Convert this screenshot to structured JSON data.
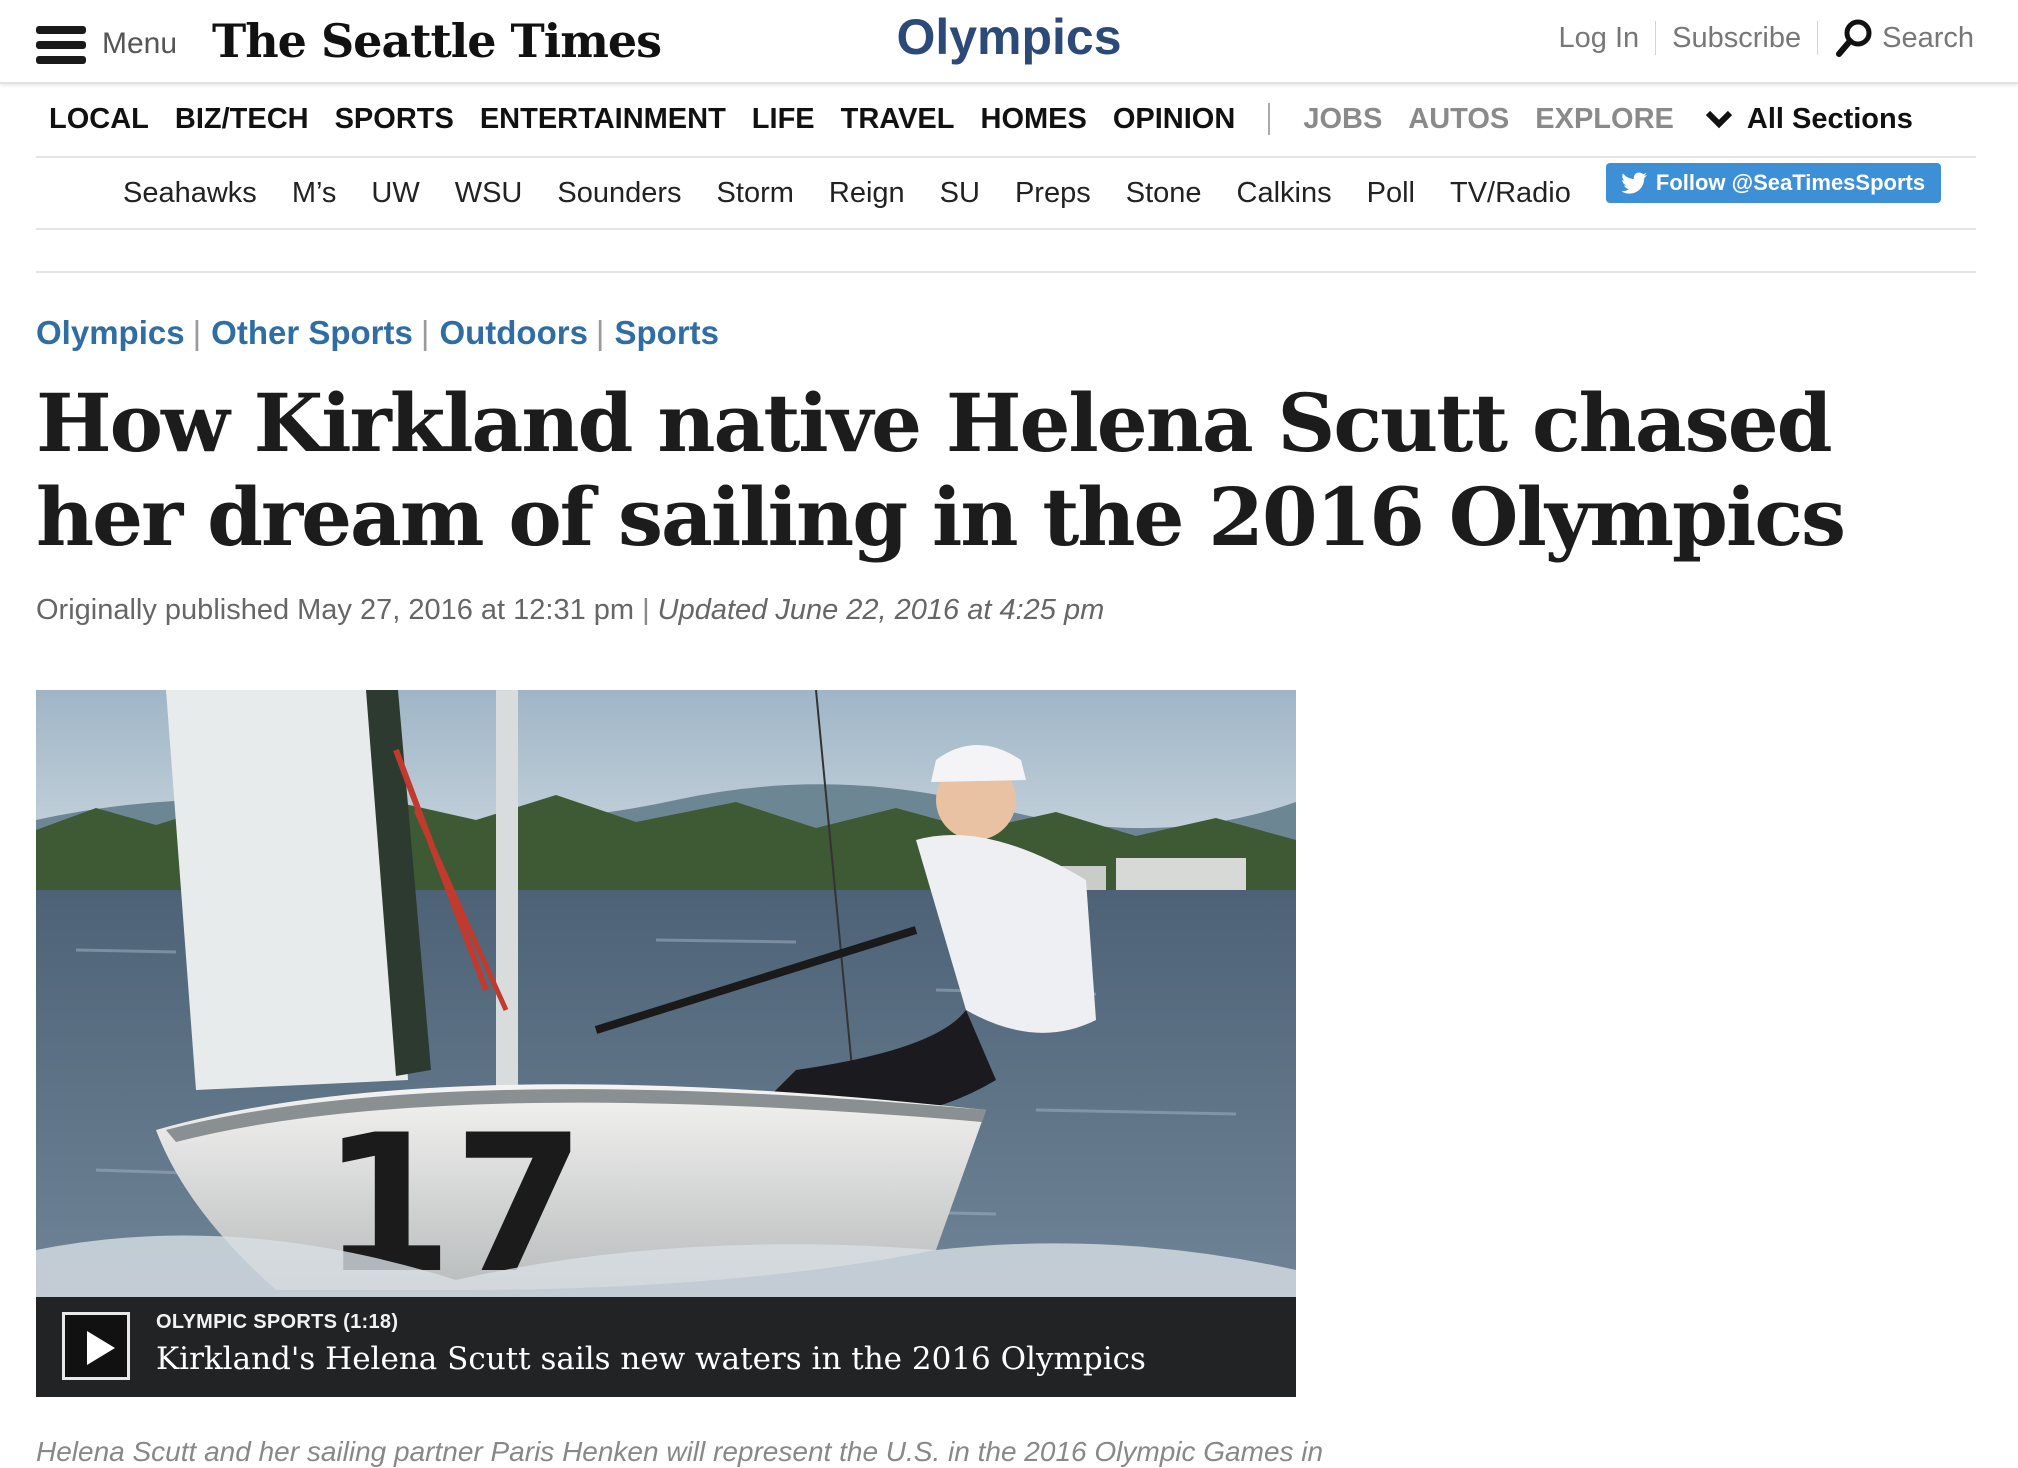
{
  "header": {
    "menu_label": "Menu",
    "logo_text": "The Seattle Times",
    "section_title": "Olympics",
    "login_label": "Log In",
    "subscribe_label": "Subscribe",
    "search_label": "Search"
  },
  "primary_nav": {
    "items": [
      "LOCAL",
      "BIZ/TECH",
      "SPORTS",
      "ENTERTAINMENT",
      "LIFE",
      "TRAVEL",
      "HOMES",
      "OPINION"
    ],
    "secondary_items": [
      "JOBS",
      "AUTOS",
      "EXPLORE"
    ],
    "all_sections_label": "All Sections"
  },
  "secondary_nav": {
    "items": [
      "Seahawks",
      "M’s",
      "UW",
      "WSU",
      "Sounders",
      "Storm",
      "Reign",
      "SU",
      "Preps",
      "Stone",
      "Calkins",
      "Poll",
      "TV/Radio"
    ],
    "follow_label": "Follow @SeaTimesSports"
  },
  "article": {
    "categories": [
      "Olympics",
      "Other Sports",
      "Outdoors",
      "Sports"
    ],
    "headline": "How Kirkland native Helena Scutt chased her dream of sailing in the 2016 Olympics",
    "published": "Originally published May 27, 2016 at 12:31 pm",
    "updated": "Updated June 22, 2016 at 4:25 pm",
    "caption_partial": "Helena Scutt and her sailing partner Paris Henken will represent the U.S. in the 2016 Olympic Games in"
  },
  "video": {
    "kicker": "OLYMPIC SPORTS (1:18)",
    "title": "Kirkland's Helena Scutt sails new waters in the 2016 Olympics",
    "sail_number": "17"
  },
  "colors": {
    "section_title": "#2c4a78",
    "category_link": "#2f6da3",
    "follow_button": "#3d8fd6",
    "muted_nav": "#8a8a8a"
  },
  "icons": [
    "hamburger-icon",
    "search-icon",
    "chevron-down-icon",
    "twitter-bird-icon",
    "play-icon"
  ]
}
